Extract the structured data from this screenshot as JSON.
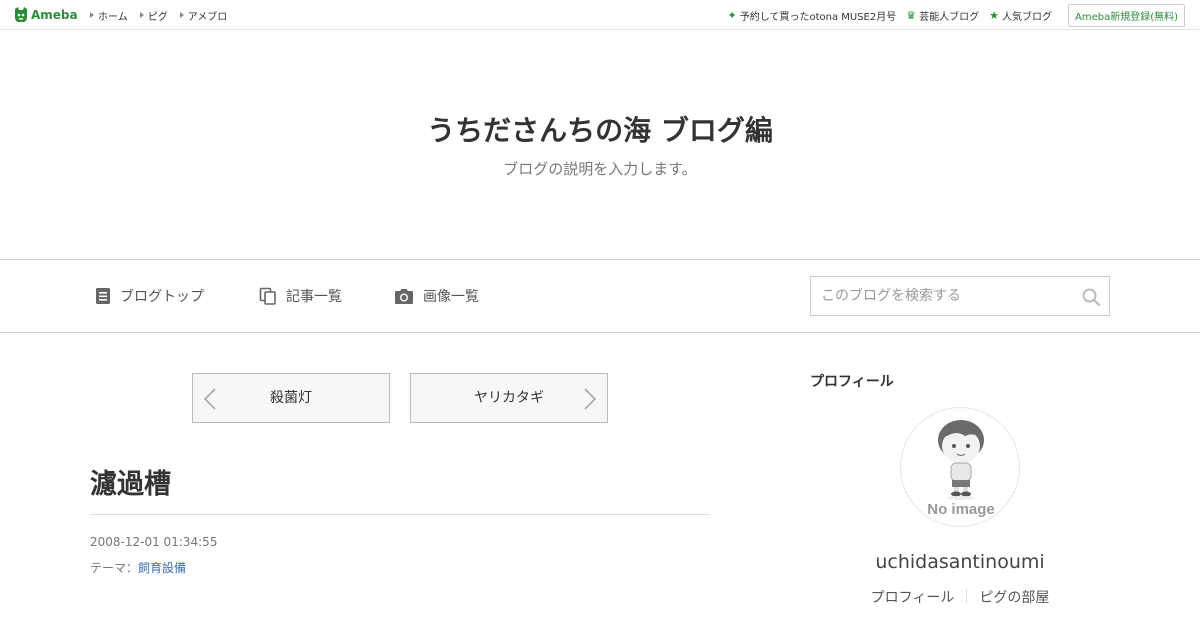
{
  "topbar": {
    "logo_text": "Ameba",
    "nav": [
      {
        "label": "ホーム"
      },
      {
        "label": "ピグ"
      },
      {
        "label": "アメブロ"
      }
    ],
    "right_links": [
      {
        "label": "予約して買ったotona MUSE2月号",
        "icon": "sparkle-icon"
      },
      {
        "label": "芸能人ブログ",
        "icon": "crown-icon"
      },
      {
        "label": "人気ブログ",
        "icon": "star-icon"
      }
    ],
    "register_label": "Ameba新規登録(無料)",
    "accent_color": "#2d8c3c"
  },
  "header": {
    "title": "うちださんちの海 ブログ編",
    "description": "ブログの説明を入力します。"
  },
  "gnav": {
    "items": [
      {
        "label": "ブログトップ",
        "icon": "document-icon"
      },
      {
        "label": "記事一覧",
        "icon": "copy-icon"
      },
      {
        "label": "画像一覧",
        "icon": "camera-icon"
      }
    ],
    "search_placeholder": "このブログを検索する"
  },
  "pager": {
    "prev_label": "殺菌灯",
    "next_label": "ヤリカタギ"
  },
  "entry": {
    "title": "濾過槽",
    "date": "2008-12-01 01:34:55",
    "theme_prefix": "テーマ：",
    "theme": "飼育設備",
    "theme_color": "#3a6fb5"
  },
  "sidebar": {
    "heading": "プロフィール",
    "avatar_text": "No image",
    "username": "uchidasantinoumi",
    "links": [
      {
        "label": "プロフィール"
      },
      {
        "label": "ピグの部屋"
      }
    ]
  }
}
